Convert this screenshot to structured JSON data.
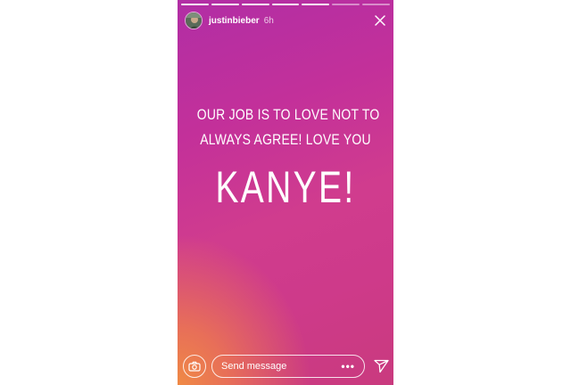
{
  "story": {
    "progress": {
      "total": 7,
      "completed": 5
    },
    "user": {
      "username": "justinbieber",
      "time_ago": "6h"
    },
    "text_lines": [
      "OUR JOB IS TO LOVE NOT TO",
      "ALWAYS AGREE! LOVE YOU"
    ],
    "headline": "KANYE!",
    "reply": {
      "placeholder": "Send message",
      "more": "•••"
    }
  },
  "icons": {
    "close": "close-icon",
    "camera": "camera-icon",
    "send": "send-icon",
    "avatar": "avatar"
  },
  "colors": {
    "gradient_top": "#b12ea5",
    "gradient_mid": "#d03c8e",
    "gradient_bottom_left": "#f08a45",
    "text": "#ffffff"
  }
}
